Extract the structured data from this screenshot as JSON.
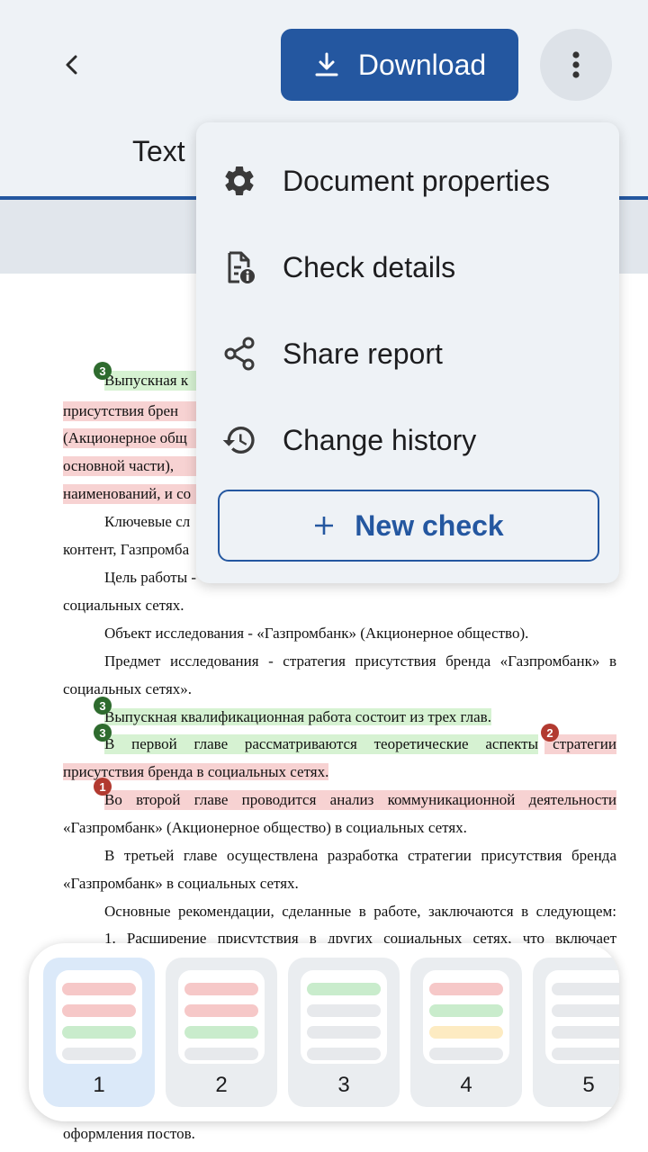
{
  "header": {
    "download_label": "Download",
    "tab_label": "Text"
  },
  "menu": {
    "items": [
      {
        "label": "Document properties",
        "icon": "gear-icon"
      },
      {
        "label": "Check details",
        "icon": "document-info-icon"
      },
      {
        "label": "Share report",
        "icon": "share-icon"
      },
      {
        "label": "Change history",
        "icon": "history-icon"
      }
    ],
    "new_check_label": "New check"
  },
  "document": {
    "lines": [
      "Выпускная  к",
      "присутствия  брен",
      "(Акционерное  общ",
      "основной  части),  ",
      "наименований, и со",
      "Ключевые  сл",
      "контент, Газпромба",
      "Цель работы -",
      "социальных сетях.",
      "Объект исследования - «Газпромбанк» (Акционерное общество).",
      "Предмет исследования - стратегия присутствия бренда «Газпромбанк» в",
      "социальных сетях».",
      "Выпускная квалификационная работа состоит из трех глав.",
      "В первой главе рассматриваются теоретические аспекты",
      "стратегии",
      "присутствия бренда в социальных сетях.",
      "Во второй главе проводится анализ коммуникационной деятельности",
      "«Газпромбанк» (Акционерное общество) в социальных сетях.",
      "В третьей главе осуществлена разработка стратегии присутствия бренда",
      "«Газпромбанк» в социальных сетях.",
      "Основные рекомендации, сделанные в работе, заключаются в следующем:",
      "1. Расширение присутствия в других социальных сетях, что включает",
      "оформления постов."
    ],
    "badges": [
      "3",
      "3",
      "3",
      "2",
      "1"
    ]
  },
  "pages": {
    "items": [
      {
        "label": "1",
        "bars": [
          "red",
          "red",
          "green",
          "gray"
        ]
      },
      {
        "label": "2",
        "bars": [
          "red",
          "red",
          "green",
          "gray"
        ]
      },
      {
        "label": "3",
        "bars": [
          "green",
          "gray",
          "gray",
          "gray"
        ]
      },
      {
        "label": "4",
        "bars": [
          "red",
          "green",
          "yellow",
          "gray"
        ]
      },
      {
        "label": "5",
        "bars": [
          "gray",
          "gray",
          "gray",
          "gray"
        ]
      }
    ],
    "selected": "1"
  },
  "colors": {
    "accent": "#2457a0",
    "highlight_green": "#d6f2d2",
    "highlight_red": "#f7d2d2",
    "highlight_yellow": "#fdebc2",
    "bar_red": "#f6c8c8",
    "bar_green": "#c9eccc",
    "bar_gray": "#e7e9ec"
  }
}
